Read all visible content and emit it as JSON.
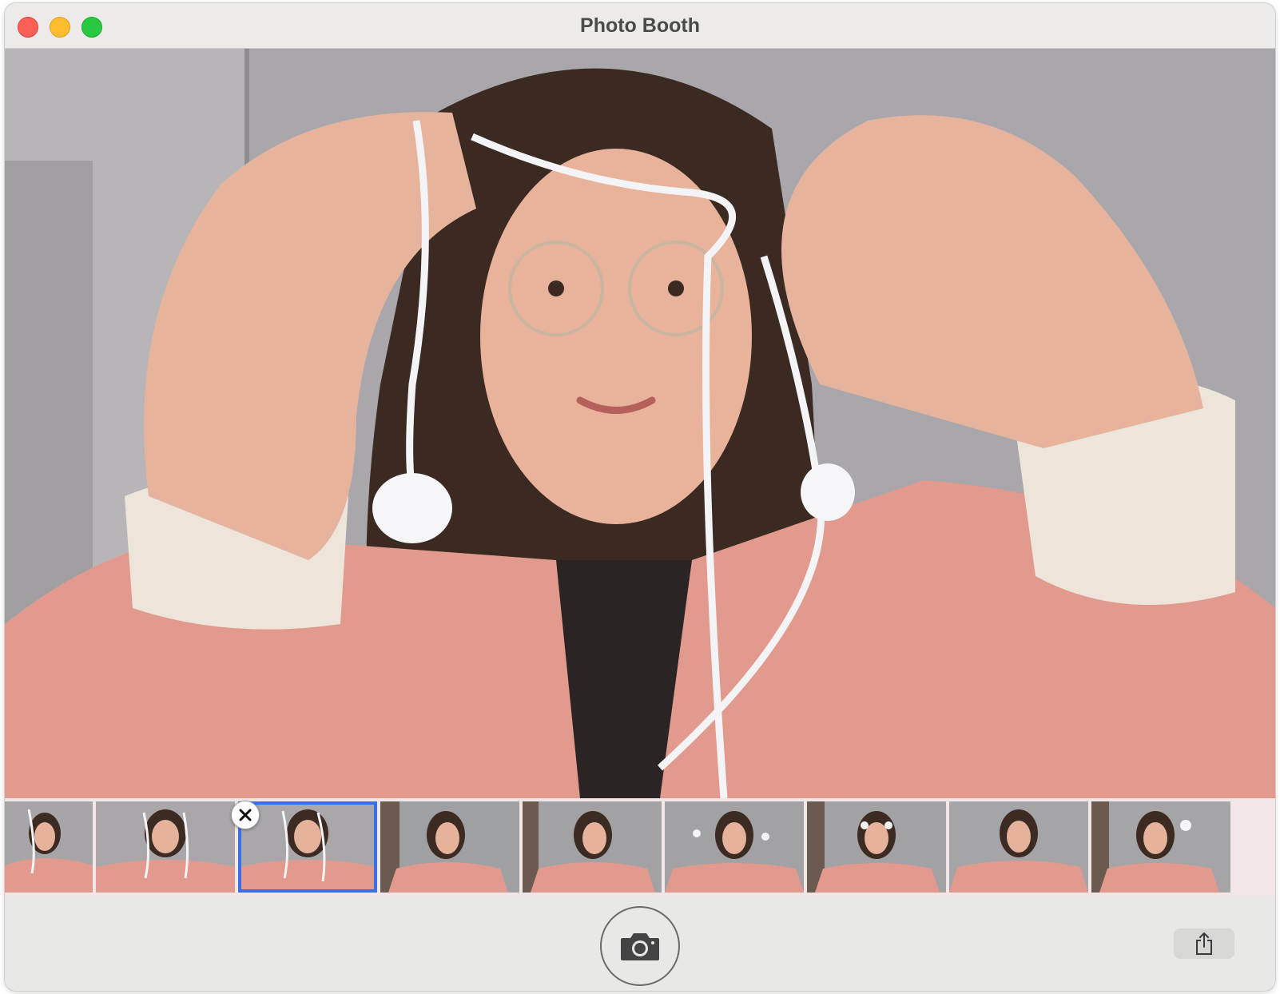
{
  "window": {
    "title": "Photo Booth"
  },
  "icons": {
    "close": "close-icon",
    "minimize": "minimize-icon",
    "zoom": "zoom-icon",
    "delete": "x-icon",
    "camera": "camera-icon",
    "share": "share-icon"
  },
  "colors": {
    "selection": "#3b6fea",
    "close": "#fe5f57",
    "minimize": "#febc2e",
    "zoom": "#28c840"
  },
  "filmstrip": {
    "thumbnail_count": 9,
    "selected_index": 2
  }
}
